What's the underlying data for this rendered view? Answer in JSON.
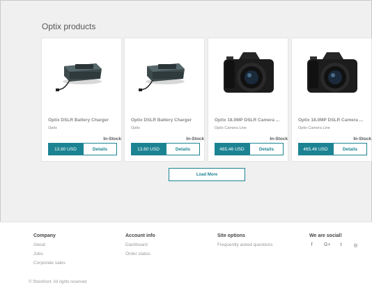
{
  "section_title": "Optix products",
  "products": [
    {
      "name": "Optix DSLR Battery Charger",
      "brand": "Optix",
      "stock": "In-Stock",
      "price": "13.80 USD",
      "details_label": "Details",
      "image": "battery-charger-image"
    },
    {
      "name": "Optix DSLR Battery Charger",
      "brand": "Optix",
      "stock": "In-Stock",
      "price": "13.80 USD",
      "details_label": "Details",
      "image": "battery-charger-image"
    },
    {
      "name": "Optix 18.0MP DSLR Camera ...",
      "brand": "Optix Camera Line",
      "stock": "In-Stock",
      "price": "465.46 USD",
      "details_label": "Details",
      "image": "dslr-camera-image"
    },
    {
      "name": "Optix 18.0MP DSLR Camera ...",
      "brand": "Optix Camera Line",
      "stock": "In-Stock",
      "price": "465.46 USD",
      "details_label": "Details",
      "image": "dslr-camera-image"
    }
  ],
  "load_more_label": "Load More",
  "footer": {
    "company": {
      "heading": "Company",
      "links": [
        "About",
        "Jobs",
        "Corporate sales"
      ]
    },
    "account": {
      "heading": "Account info",
      "links": [
        "Dashboard",
        "Order status"
      ]
    },
    "site": {
      "heading": "Site options",
      "links": [
        "Frequently asked questions"
      ]
    },
    "social": {
      "heading": "We are social!",
      "icons": [
        "facebook-icon",
        "google-plus-icon",
        "twitter-icon",
        "instagram-icon"
      ],
      "glyphs": [
        "f",
        "G+",
        "t",
        "◎"
      ]
    },
    "copyright": "© Storefront. All rights reserved"
  },
  "colors": {
    "accent": "#1c8393",
    "background": "#f0f0f0"
  }
}
